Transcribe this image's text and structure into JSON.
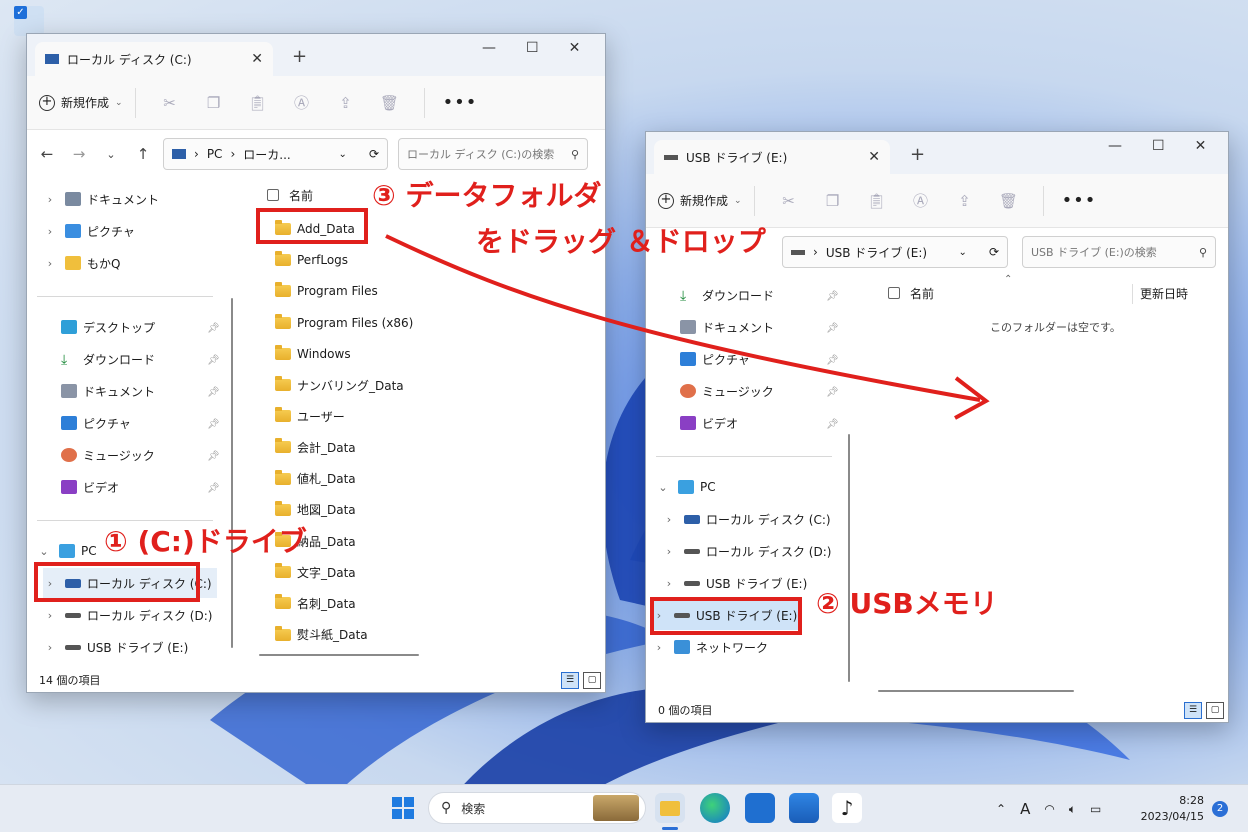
{
  "colors": {
    "annotation": "#e0201c",
    "folder": "#f0bf3c",
    "accent": "#2b6fd6",
    "selection": "#cfe3f8"
  },
  "window1": {
    "tab_title": "ローカル ディスク (C:)",
    "toolbar": {
      "new_label": "新規作成"
    },
    "address": {
      "pc": "PC",
      "crumb": "ローカ..."
    },
    "search_placeholder": "ローカル ディスク (C:)の検索",
    "nav": {
      "top_items": [
        {
          "label": "ドキュメント",
          "icon": "document-icon"
        },
        {
          "label": "ピクチャ",
          "icon": "picture-icon"
        },
        {
          "label": "もかQ",
          "icon": "folder-icon"
        }
      ],
      "quick_items": [
        {
          "label": "デスクトップ",
          "icon": "desktop-icon"
        },
        {
          "label": "ダウンロード",
          "icon": "download-icon"
        },
        {
          "label": "ドキュメント",
          "icon": "document-icon"
        },
        {
          "label": "ピクチャ",
          "icon": "picture-icon"
        },
        {
          "label": "ミュージック",
          "icon": "music-icon"
        },
        {
          "label": "ビデオ",
          "icon": "video-icon"
        }
      ],
      "pc_label": "PC",
      "drives": [
        "ローカル ディスク (C:)",
        "ローカル ディスク (D:)",
        "USB ドライブ (E:)"
      ]
    },
    "column_name": "名前",
    "files": [
      "Add_Data",
      "PerfLogs",
      "Program Files",
      "Program Files (x86)",
      "Windows",
      "ナンバリング_Data",
      "ユーザー",
      "会計_Data",
      "値札_Data",
      "地図_Data",
      "納品_Data",
      "文字_Data",
      "名刺_Data",
      "熨斗紙_Data"
    ],
    "status": "14 個の項目"
  },
  "window2": {
    "tab_title": "USB ドライブ (E:)",
    "toolbar": {
      "new_label": "新規作成"
    },
    "address": {
      "crumb": "USB ドライブ (E:)"
    },
    "search_placeholder": "USB ドライブ (E:)の検索",
    "nav": {
      "quick_items": [
        {
          "label": "ダウンロード",
          "icon": "download-icon"
        },
        {
          "label": "ドキュメント",
          "icon": "document-icon"
        },
        {
          "label": "ピクチャ",
          "icon": "picture-icon"
        },
        {
          "label": "ミュージック",
          "icon": "music-icon"
        },
        {
          "label": "ビデオ",
          "icon": "video-icon"
        }
      ],
      "pc_label": "PC",
      "drives": [
        "ローカル ディスク (C:)",
        "ローカル ディスク (D:)",
        "USB ドライブ (E:)",
        "USB ドライブ (E:)"
      ],
      "network": "ネットワーク"
    },
    "column_name": "名前",
    "column_date": "更新日時",
    "empty_message": "このフォルダーは空です。",
    "status": "0 個の項目"
  },
  "annotations": {
    "step1": "① (C:)ドライブ",
    "step2": "② USBメモリ",
    "step3_line1": "③ データフォルダ",
    "step3_line2": "をドラッグ ＆ドロップ"
  },
  "taskbar": {
    "search_label": "検索",
    "ime": "A",
    "time": "8:28",
    "date": "2023/04/15",
    "notifications": "2"
  }
}
